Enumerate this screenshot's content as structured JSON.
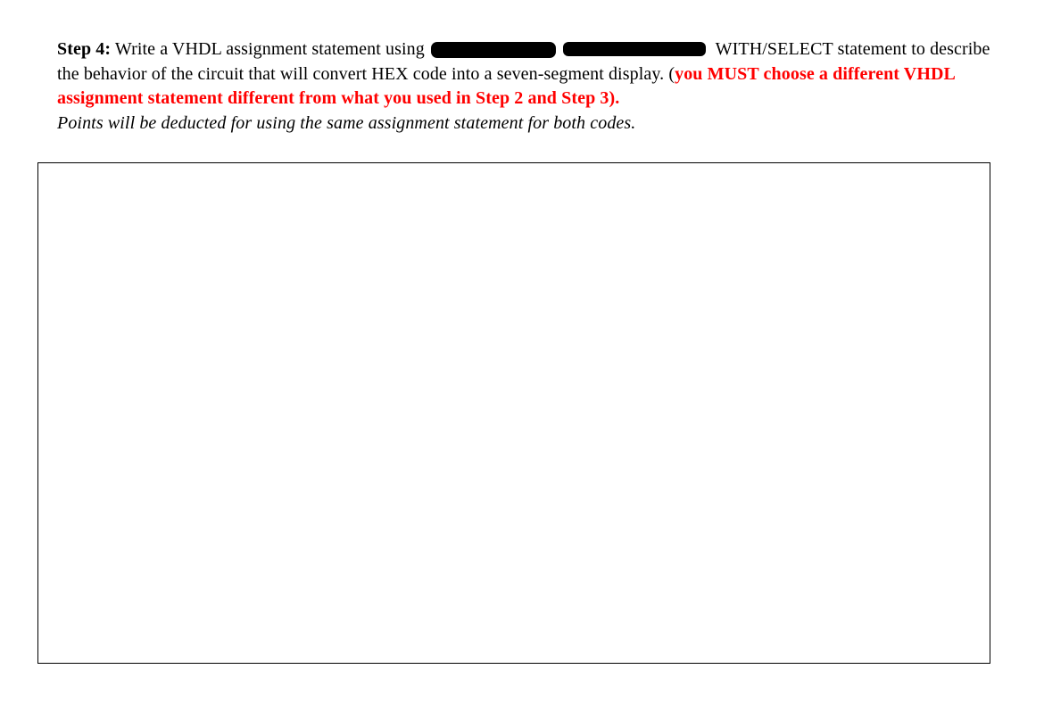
{
  "prompt": {
    "step_label": "Step 4:",
    "part1": " Write a VHDL assignment statement using",
    "part2": " WITH/SELECT statement to describe the behavior of the circuit that will convert HEX code into a seven-segment display. (",
    "red1": "you MUST choose a different VHDL assignment statement different from what you used in Step 2 and Step 3).",
    "italic_note": " Points will be deducted for using the same assignment statement for both codes."
  }
}
